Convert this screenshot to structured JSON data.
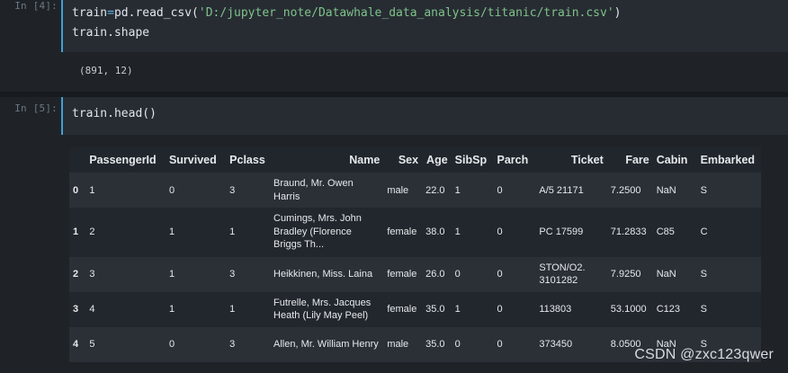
{
  "cells": [
    {
      "prompt": "In [4]:",
      "code": {
        "line1_var": "train",
        "line1_op": "=",
        "line1_func": "pd.read_csv(",
        "line1_str": "'D:/jupyter_note/Datawhale_data_analysis/titanic/train.csv'",
        "line1_close": ")",
        "line2": "train.shape"
      },
      "output": "(891, 12)"
    },
    {
      "prompt": "In [5]:",
      "code": {
        "line1": "train.head()"
      }
    }
  ],
  "dataframe": {
    "columns": [
      "PassengerId",
      "Survived",
      "Pclass",
      "Name",
      "Sex",
      "Age",
      "SibSp",
      "Parch",
      "Ticket",
      "Fare",
      "Cabin",
      "Embarked"
    ],
    "rows": [
      {
        "index": "0",
        "cells": [
          "1",
          "0",
          "3",
          "Braund, Mr. Owen Harris",
          "male",
          "22.0",
          "1",
          "0",
          "A/5 21171",
          "7.2500",
          "NaN",
          "S"
        ]
      },
      {
        "index": "1",
        "cells": [
          "2",
          "1",
          "1",
          "Cumings, Mrs. John Bradley (Florence Briggs Th...",
          "female",
          "38.0",
          "1",
          "0",
          "PC 17599",
          "71.2833",
          "C85",
          "C"
        ]
      },
      {
        "index": "2",
        "cells": [
          "3",
          "1",
          "3",
          "Heikkinen, Miss. Laina",
          "female",
          "26.0",
          "0",
          "0",
          "STON/O2. 3101282",
          "7.9250",
          "NaN",
          "S"
        ]
      },
      {
        "index": "3",
        "cells": [
          "4",
          "1",
          "1",
          "Futrelle, Mrs. Jacques Heath (Lily May Peel)",
          "female",
          "35.0",
          "1",
          "0",
          "113803",
          "53.1000",
          "C123",
          "S"
        ]
      },
      {
        "index": "4",
        "cells": [
          "5",
          "0",
          "3",
          "Allen, Mr. William Henry",
          "male",
          "35.0",
          "0",
          "0",
          "373450",
          "8.0500",
          "NaN",
          "S"
        ]
      }
    ]
  },
  "watermark": "CSDN @zxc123qwer",
  "colors": {
    "background": "#1f2328",
    "input_bg": "#272c33",
    "active_border": "#3fa0d6",
    "string": "#7fc38a",
    "operator": "#5fb3e6",
    "text": "#e1e5ea"
  }
}
